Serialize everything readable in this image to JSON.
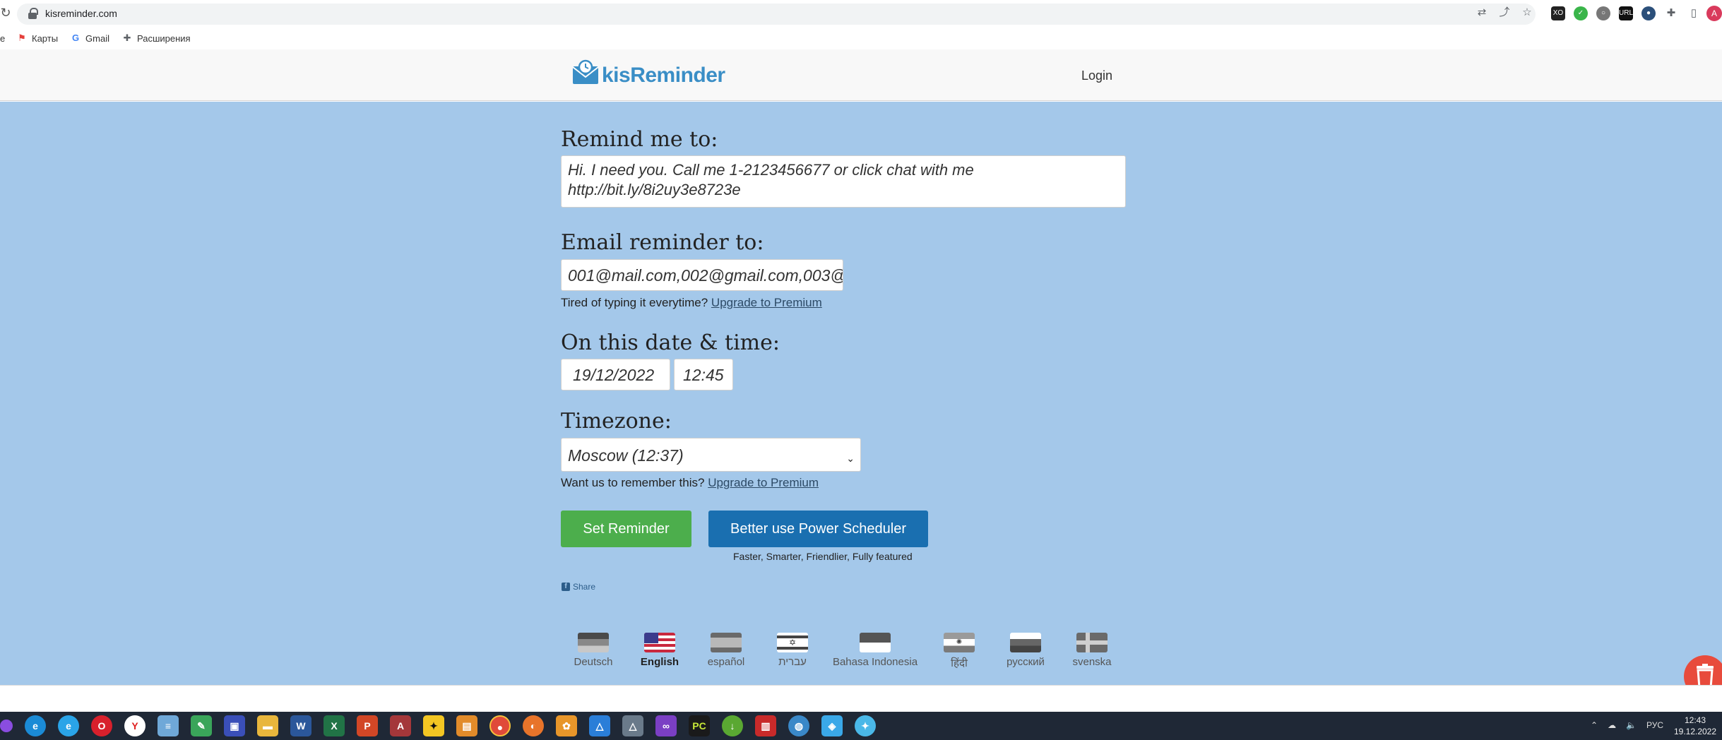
{
  "browser": {
    "url": "kisreminder.com",
    "bookmarks": [
      {
        "label": "Карты"
      },
      {
        "label": "Gmail"
      },
      {
        "label": "Расширения"
      }
    ],
    "profile_initial": "A"
  },
  "header": {
    "brand": "kisReminder",
    "login_label": "Login"
  },
  "form": {
    "remind_label": "Remind me to:",
    "remind_value": "Hi. I need you. Call me 1-2123456677 or click chat with me http://bit.ly/8i2uy3e8723e",
    "email_label": "Email reminder to:",
    "email_value": "001@mail.com,002@gmail.com,003@",
    "email_note": "Tired of typing it everytime?",
    "upgrade_link": "Upgrade to Premium",
    "datetime_label": "On this date & time:",
    "date_value": "19/12/2022",
    "time_value": "12:45",
    "timezone_label": "Timezone:",
    "timezone_value": "Moscow (12:37)",
    "timezone_note": "Want us to remember this?",
    "set_reminder_label": "Set Reminder",
    "power_scheduler_label": "Better use Power Scheduler",
    "power_tagline": "Faster, Smarter, Friendlier, Fully featured",
    "share_label": "Share"
  },
  "languages": [
    {
      "name": "Deutsch",
      "active": false
    },
    {
      "name": "English",
      "active": true
    },
    {
      "name": "español",
      "active": false
    },
    {
      "name": "עברית",
      "active": false
    },
    {
      "name": "Bahasa Indonesia",
      "active": false
    },
    {
      "name": "हिंदी",
      "active": false
    },
    {
      "name": "русский",
      "active": false
    },
    {
      "name": "svenska",
      "active": false
    }
  ],
  "taskbar": {
    "tray_lang": "РУС",
    "time": "12:43",
    "date": "19.12.2022"
  }
}
